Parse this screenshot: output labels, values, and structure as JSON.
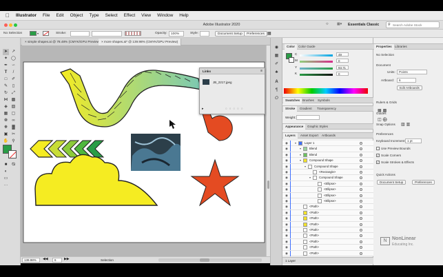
{
  "menubar": {
    "app": "Illustrator",
    "items": [
      "File",
      "Edit",
      "Object",
      "Type",
      "Select",
      "Effect",
      "View",
      "Window",
      "Help"
    ]
  },
  "window": {
    "title": "Adobe Illustrator 2020",
    "workspace": "Essentials Classic",
    "search_placeholder": "Search Adobe Stock"
  },
  "control_bar": {
    "selection": "No Selection",
    "stroke_label": "Stroke:",
    "opacity_label": "Opacity:",
    "opacity_value": "100%",
    "style_label": "Style:",
    "doc_setup": "Document Setup",
    "preferences": "Preferences"
  },
  "doc_tabs": [
    {
      "label": "simple shapes.ai @ 78.48% (CMYK/GPU Preview)"
    },
    {
      "label": "more shapes.ai* @ 139.98% (CMYK/GPU Preview)"
    }
  ],
  "statusbar": {
    "zoom": "139.98%",
    "artboard": "6",
    "tool": "Selection"
  },
  "links_panel": {
    "title": "Links",
    "file": "JB_2217.jpeg"
  },
  "color_panel": {
    "tabs": [
      "Color",
      "Color Guide"
    ],
    "sliders": [
      {
        "label": "C",
        "value": "49"
      },
      {
        "label": "M",
        "value": "0"
      },
      {
        "label": "Y",
        "value": "93.71"
      },
      {
        "label": "K",
        "value": "0"
      }
    ]
  },
  "swatch_tabs": [
    "Swatches",
    "Brushes",
    "Symbols"
  ],
  "stroke_tabs": [
    "Stroke",
    "Gradient",
    "Transparency"
  ],
  "stroke": {
    "weight_label": "Weight:"
  },
  "appearance_tabs": [
    "Appearance",
    "Graphic Styles"
  ],
  "layers_tabs": [
    "Layers",
    "Asset Export",
    "Artboards"
  ],
  "layers": [
    {
      "name": "Layer 1",
      "indent": 0,
      "color": "#3d6fff"
    },
    {
      "name": "Blend",
      "indent": 1,
      "color": "#9bd49e"
    },
    {
      "name": "Blend",
      "indent": 1,
      "color": "#6bc25e"
    },
    {
      "name": "Compound Shape",
      "indent": 1,
      "color": "#f3e22b"
    },
    {
      "name": "Compound Shape",
      "indent": 2,
      "color": "#ffffff"
    },
    {
      "name": "<Rectangle>",
      "indent": 3,
      "color": "#ffffff"
    },
    {
      "name": "Compound Shape",
      "indent": 3,
      "color": "#ffffff"
    },
    {
      "name": "<Ellipse>",
      "indent": 4,
      "color": "#ffffff"
    },
    {
      "name": "<Ellipse>",
      "indent": 4,
      "color": "#ffffff"
    },
    {
      "name": "<Ellipse>",
      "indent": 4,
      "color": "#ffffff"
    },
    {
      "name": "<Ellipse>",
      "indent": 4,
      "color": "#ffffff"
    },
    {
      "name": "<Path>",
      "indent": 1,
      "color": "#ffffff"
    },
    {
      "name": "<Path>",
      "indent": 1,
      "color": "#f3e22b"
    },
    {
      "name": "<Path>",
      "indent": 1,
      "color": "#f3e22b"
    },
    {
      "name": "<Path>",
      "indent": 1,
      "color": "#f3e22b"
    },
    {
      "name": "<Path>",
      "indent": 1,
      "color": "#ffffff"
    },
    {
      "name": "<Path>",
      "indent": 1,
      "color": "#ffffff"
    },
    {
      "name": "<Path>",
      "indent": 1,
      "color": "#ffffff"
    },
    {
      "name": "<Path>",
      "indent": 1,
      "color": "#ffffff"
    },
    {
      "name": "<Path>",
      "indent": 1,
      "color": "#ffffff"
    }
  ],
  "layers_footer": "1 Layer",
  "properties": {
    "tabs": [
      "Properties",
      "Libraries"
    ],
    "selection": "No Selection",
    "document_heading": "Document",
    "units_label": "Units:",
    "units_value": "Points",
    "artboard_label": "Artboard:",
    "artboard_value": "6",
    "edit_artboards": "Edit Artboards",
    "ruler_grids": "Rulers & Grids",
    "guides": "Guides",
    "snap_options": "Snap Options",
    "preferences_heading": "Preferences",
    "keyboard_increment_label": "Keyboard Increment:",
    "keyboard_increment_value": "1 pt",
    "use_preview_bounds": "Use Preview Bounds",
    "scale_corners": "Scale Corners",
    "scale_strokes": "Scale Strokes & Effects",
    "quick_actions": "Quick Actions",
    "document_setup": "Document Setup",
    "preferences": "Preferences"
  },
  "watermark": {
    "line1": "NonLinear",
    "line2": "Educating Inc."
  },
  "colors": {
    "fill": "#2a9d46",
    "green": "#2a9d46",
    "yellow": "#f7ec1c",
    "orange": "#e44b22"
  }
}
